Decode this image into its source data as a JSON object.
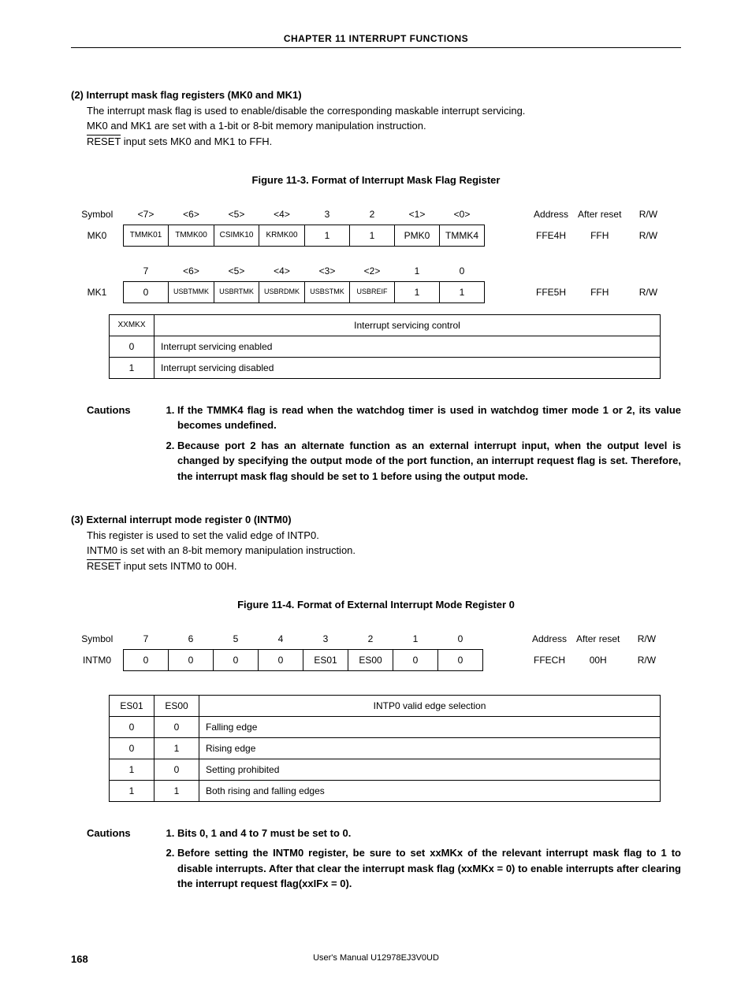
{
  "chapter_header": "CHAPTER  11   INTERRUPT  FUNCTIONS",
  "sec2": {
    "title": "(2)  Interrupt mask flag registers (MK0 and MK1)",
    "p1": "The interrupt mask flag is used to enable/disable the corresponding maskable interrupt servicing.",
    "p2": "MK0 and MK1 are set with a 1-bit or 8-bit memory manipulation instruction.",
    "p3a": "RESET",
    "p3b": " input sets MK0 and MK1 to FFH."
  },
  "fig113_title": "Figure 11-3.  Format of Interrupt Mask Flag Register",
  "reg1": {
    "symbol_label": "Symbol",
    "address_label": "Address",
    "after_reset_label": "After reset",
    "rw_label": "R/W",
    "row0": {
      "sym": "MK0",
      "h": [
        "<7>",
        "<6>",
        "<5>",
        "<4>",
        "3",
        "2",
        "<1>",
        "<0>"
      ],
      "c": [
        "TMMK01",
        "TMMK00",
        "CSIMK10",
        "KRMK00",
        "1",
        "1",
        "PMK0",
        "TMMK4"
      ],
      "addr": "FFE4H",
      "reset": "FFH",
      "rw": "R/W"
    },
    "row1": {
      "sym": "MK1",
      "h": [
        "7",
        "<6>",
        "<5>",
        "<4>",
        "<3>",
        "<2>",
        "1",
        "0"
      ],
      "c": [
        "0",
        "USBTMMK",
        "USBRTMK",
        "USBRDMK",
        "USBSTMK",
        "USBREIF",
        "1",
        "1"
      ],
      "addr": "FFE5H",
      "reset": "FFH",
      "rw": "R/W"
    }
  },
  "lookup1": {
    "h1": "XXMKX",
    "h2": "Interrupt servicing control",
    "r0": {
      "v": "0",
      "t": "Interrupt servicing enabled"
    },
    "r1": {
      "v": "1",
      "t": "Interrupt servicing disabled"
    }
  },
  "cautions1": {
    "label": "Cautions",
    "li1": "If the TMMK4 flag is read when the watchdog timer is used in watchdog timer mode 1 or 2, its value becomes undefined.",
    "li2": "Because port 2 has an alternate function as an external interrupt input, when the output level is changed by specifying the output mode of the port function, an interrupt request flag is set.  Therefore, the interrupt mask flag should be set to 1 before using the output mode."
  },
  "sec3": {
    "title": "(3)  External interrupt mode register 0 (INTM0)",
    "p1": "This register is used to set the valid edge of INTP0.",
    "p2": "INTM0 is set with an 8-bit memory manipulation instruction.",
    "p3a": "RESET",
    "p3b": " input sets INTM0 to 00H."
  },
  "fig114_title": "Figure 11-4.  Format of External Interrupt Mode Register 0",
  "reg2": {
    "symbol_label": "Symbol",
    "sym": "INTM0",
    "h": [
      "7",
      "6",
      "5",
      "4",
      "3",
      "2",
      "1",
      "0"
    ],
    "c": [
      "0",
      "0",
      "0",
      "0",
      "ES01",
      "ES00",
      "0",
      "0"
    ],
    "addr_label": "Address",
    "addr": "FFECH",
    "reset_label": "After reset",
    "reset": "00H",
    "rw_label": "R/W",
    "rw": "R/W"
  },
  "lookup2": {
    "h1": "ES01",
    "h2": "ES00",
    "h3": "INTP0 valid edge selection",
    "r0": {
      "a": "0",
      "b": "0",
      "t": "Falling edge"
    },
    "r1": {
      "a": "0",
      "b": "1",
      "t": "Rising edge"
    },
    "r2": {
      "a": "1",
      "b": "0",
      "t": "Setting prohibited"
    },
    "r3": {
      "a": "1",
      "b": "1",
      "t": "Both rising and falling edges"
    }
  },
  "cautions2": {
    "label": "Cautions",
    "li1": "Bits 0, 1 and 4 to 7 must be set to 0.",
    "li2": "Before setting the INTM0 register, be sure to set xxMKx of the relevant interrupt mask flag to 1 to disable interrupts.  After that clear the interrupt mask flag (xxMKx = 0) to enable interrupts after clearing the interrupt request flag(xxIFx = 0)."
  },
  "footer": {
    "page": "168",
    "manual": "User's Manual  U12978EJ3V0UD"
  }
}
